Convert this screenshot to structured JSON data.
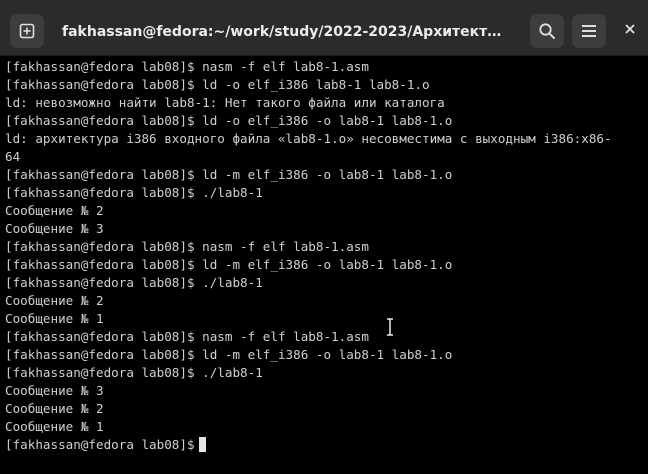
{
  "window": {
    "title": "fakhassan@fedora:~/work/study/2022-2023/Архитектура ком...",
    "icons": {
      "new_tab": "plus-square-icon",
      "search": "search-icon",
      "menu": "hamburger-menu-icon",
      "close": "close-icon"
    }
  },
  "terminal": {
    "lines": [
      "[fakhassan@fedora lab08]$ nasm -f elf lab8-1.asm",
      "[fakhassan@fedora lab08]$ ld -o elf_i386 lab8-1 lab8-1.o",
      "ld: невозможно найти lab8-1: Нет такого файла или каталога",
      "[fakhassan@fedora lab08]$ ld -o elf_i386 -o lab8-1 lab8-1.o",
      "ld: архитектура i386 входного файла «lab8-1.o» несовместима с выходным i386:x86-",
      "64",
      "[fakhassan@fedora lab08]$ ld -m elf_i386 -o lab8-1 lab8-1.o",
      "[fakhassan@fedora lab08]$ ./lab8-1",
      "Сообщение № 2",
      "Сообщение № 3",
      "[fakhassan@fedora lab08]$ nasm -f elf lab8-1.asm",
      "[fakhassan@fedora lab08]$ ld -m elf_i386 -o lab8-1 lab8-1.o",
      "[fakhassan@fedora lab08]$ ./lab8-1",
      "Сообщение № 2",
      "Сообщение № 1",
      "[fakhassan@fedora lab08]$ nasm -f elf lab8-1.asm",
      "[fakhassan@fedora lab08]$ ld -m elf_i386 -o lab8-1 lab8-1.o",
      "[fakhassan@fedora lab08]$ ./lab8-1",
      "Сообщение № 3",
      "Сообщение № 2",
      "Сообщение № 1"
    ],
    "prompt": "[fakhassan@fedora lab08]$"
  },
  "colors": {
    "titlebar_bg": "#2b2b2b",
    "button_bg": "#3d3d3d",
    "terminal_bg": "#000000",
    "terminal_fg": "#d0d0d0"
  }
}
